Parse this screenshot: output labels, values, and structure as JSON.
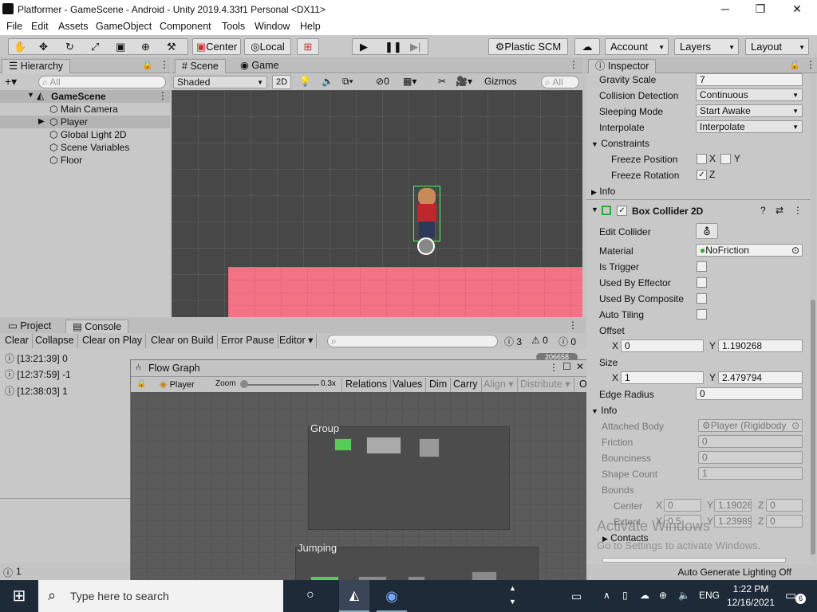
{
  "window": {
    "title": "Platformer - GameScene - Android - Unity 2019.4.33f1 Personal <DX11>",
    "min": "─",
    "max": "❐",
    "close": "✕"
  },
  "menu": [
    "File",
    "Edit",
    "Assets",
    "GameObject",
    "Component",
    "Tools",
    "Window",
    "Help"
  ],
  "toolbar": {
    "center": "Center",
    "local": "Local",
    "plastic": "Plastic SCM",
    "account": "Account",
    "layers": "Layers",
    "layout": "Layout"
  },
  "hierarchy": {
    "tab": "Hierarchy",
    "search_placeholder": "All",
    "scene": "GameScene",
    "items": [
      "Main Camera",
      "Player",
      "Global Light 2D",
      "Scene Variables",
      "Floor"
    ]
  },
  "scene": {
    "tabs": [
      "Scene",
      "Game"
    ],
    "shading": "Shaded",
    "mode2d": "2D",
    "hidden_count": "0",
    "gizmos": "Gizmos",
    "search_placeholder": "All"
  },
  "console": {
    "tabs": [
      "Project",
      "Console"
    ],
    "buttons": [
      "Clear",
      "Collapse",
      "Clear on Play",
      "Clear on Build",
      "Error Pause",
      "Editor"
    ],
    "counts": {
      "info": "3",
      "warn": "0",
      "error": "0"
    },
    "logs": [
      "[13:21:39] 0",
      "[12:37:59] -1",
      "[12:38:03] 1"
    ],
    "hidden_badge": "206658",
    "status_count": "1"
  },
  "flowgraph": {
    "title": "Flow Graph",
    "target": "Player",
    "zoom_label": "Zoom",
    "zoom_value": "0.3x",
    "zoom": 0.3,
    "buttons": [
      "Relations",
      "Values",
      "Dim",
      "Carry",
      "Align",
      "Distribute",
      "O"
    ],
    "groups": [
      "Group",
      "Jumping"
    ]
  },
  "inspector": {
    "tab": "Inspector",
    "rb": {
      "gravity_label": "Gravity Scale",
      "gravity": "7",
      "collision_label": "Collision Detection",
      "collision": "Continuous",
      "sleeping_label": "Sleeping Mode",
      "sleeping": "Start Awake",
      "interp_label": "Interpolate",
      "interp": "Interpolate",
      "constraints": "Constraints",
      "freeze_pos": "Freeze Position",
      "freeze_rot": "Freeze Rotation",
      "x": "X",
      "y": "Y",
      "z": "Z",
      "info": "Info"
    },
    "collider": {
      "title": "Box Collider 2D",
      "edit_label": "Edit Collider",
      "material_label": "Material",
      "material": "NoFriction",
      "trigger": "Is Trigger",
      "effector": "Used By Effector",
      "composite": "Used By Composite",
      "tiling": "Auto Tiling",
      "offset": "Offset",
      "offset_x": "0",
      "offset_y": "1.190268",
      "size": "Size",
      "size_x": "1",
      "size_y": "2.479794",
      "radius_label": "Edge Radius",
      "radius": "0",
      "info": "Info",
      "body_label": "Attached Body",
      "body": "Player (Rigidbody",
      "friction_label": "Friction",
      "friction": "0",
      "bounce_label": "Bounciness",
      "bounce": "0",
      "shapes_label": "Shape Count",
      "shapes": "1",
      "bounds": "Bounds",
      "center": "Center",
      "center_x": "0",
      "center_y": "1.19026",
      "center_z": "0",
      "extent": "Extent",
      "extent_x": "0.5",
      "extent_y": "1.23989",
      "extent_z": "0",
      "contacts": "Contacts"
    }
  },
  "watermark": {
    "line1": "Activate Windows",
    "line2": "Go to Settings to activate Windows."
  },
  "statusbar": {
    "lighting": "Auto Generate Lighting Off"
  },
  "taskbar": {
    "search_placeholder": "Type here to search",
    "lang": "ENG",
    "time": "1:22 PM",
    "date": "12/16/2021",
    "notif_count": "6"
  },
  "colors": {
    "floor": "#f37385",
    "scene_bg": "#474747",
    "graph_bg": "#5b5b5b"
  }
}
